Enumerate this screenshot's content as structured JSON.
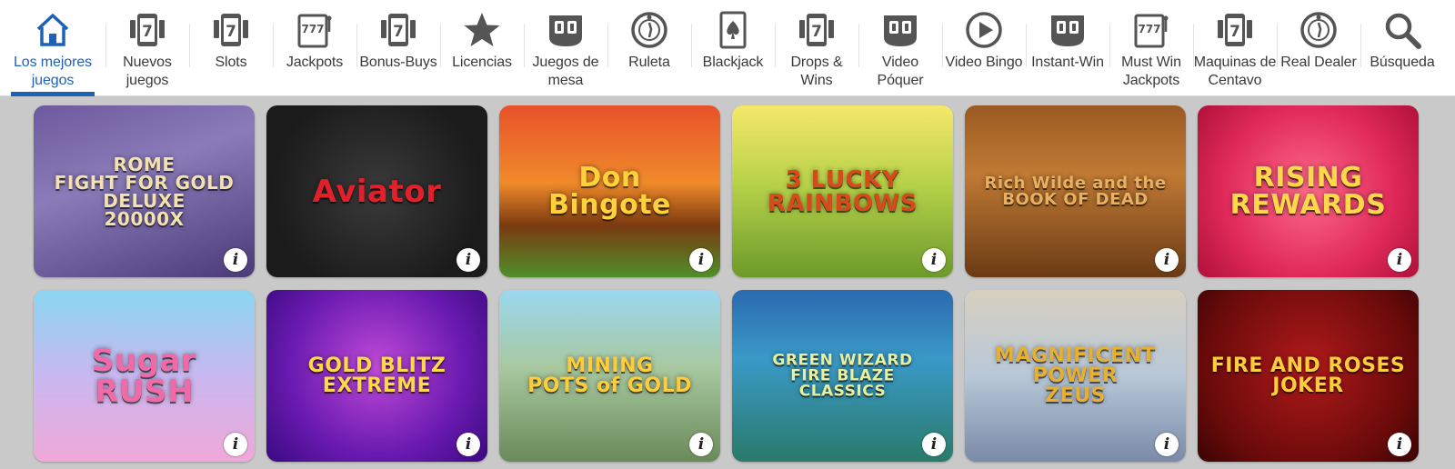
{
  "nav": {
    "items": [
      {
        "label": "Los mejores\njuegos",
        "icon": "home-icon",
        "active": true
      },
      {
        "label": "Nuevos\njuegos",
        "icon": "slot-phone-icon"
      },
      {
        "label": "Slots",
        "icon": "slot-phone-icon"
      },
      {
        "label": "Jackpots",
        "icon": "triple-seven-icon"
      },
      {
        "label": "Bonus-Buys",
        "icon": "slot-phone-icon"
      },
      {
        "label": "Licencias",
        "icon": "star-icon"
      },
      {
        "label": "Juegos de\nmesa",
        "icon": "video-poker-icon"
      },
      {
        "label": "Ruleta",
        "icon": "roulette-icon"
      },
      {
        "label": "Blackjack",
        "icon": "spade-card-icon"
      },
      {
        "label": "Drops &\nWins",
        "icon": "slot-phone-icon"
      },
      {
        "label": "Video\nPóquer",
        "icon": "video-poker-icon"
      },
      {
        "label": "Video Bingo",
        "icon": "play-icon"
      },
      {
        "label": "Instant-Win",
        "icon": "video-poker-icon"
      },
      {
        "label": "Must Win\nJackpots",
        "icon": "triple-seven-icon"
      },
      {
        "label": "Maquinas de\nCentavo",
        "icon": "slot-phone-icon"
      },
      {
        "label": "Real Dealer",
        "icon": "roulette-icon"
      },
      {
        "label": "Búsqueda",
        "icon": "search-icon"
      }
    ],
    "accent": "#1e62b8"
  },
  "games": [
    {
      "name": "ROME\nFIGHT FOR GOLD\nDELUXE\n20000X",
      "bg": "linear-gradient(160deg,#6d5a9e 0%,#8b7bb8 40%,#4a3a78 100%)",
      "color": "#f2e2b0",
      "size": "20px"
    },
    {
      "name": "Aviator",
      "bg": "radial-gradient(circle at 50% 50%,#3a3a3a 0%,#1b1b1b 75%)",
      "color": "#e0202a",
      "size": "34px"
    },
    {
      "name": "Don\nBingote",
      "bg": "linear-gradient(180deg,#e8522a 0%,#f08a2a 45%,#7a3a10 70%,#4f8f2a 100%)",
      "color": "#ffd23a",
      "size": "30px"
    },
    {
      "name": "3 LUCKY\nRAINBOWS",
      "bg": "linear-gradient(180deg,#f5e86a 0%,#b8d24a 45%,#6c9a2a 100%)",
      "color": "#d84a1a",
      "size": "26px"
    },
    {
      "name": "Rich Wilde and the\nBOOK OF DEAD",
      "bg": "linear-gradient(180deg,#9a5a22 0%,#c07a34 40%,#6a3a14 100%)",
      "color": "#e9b060",
      "size": "18px"
    },
    {
      "name": "RISING\nREWARDS",
      "bg": "radial-gradient(circle at 50% 50%,#ff6a8a 0%,#e02a5a 60%,#b0103a 100%)",
      "color": "#ffd84a",
      "size": "30px"
    },
    {
      "name": "Sugar\nRUSH",
      "bg": "linear-gradient(180deg,#8ad6f0 0%,#c9b8f0 50%,#f0a8d8 100%)",
      "color": "#f06aa8",
      "size": "34px"
    },
    {
      "name": "GOLD BLITZ\nEXTREME",
      "bg": "radial-gradient(circle at 50% 45%,#c04ad8 0%,#6a1ab0 60%,#3a0a80 100%)",
      "color": "#ffd84a",
      "size": "22px"
    },
    {
      "name": "MINING\nPOTS of GOLD",
      "bg": "linear-gradient(180deg,#9ad8f0 0%,#a8c8a0 45%,#6a8a5a 100%)",
      "color": "#ffcc3a",
      "size": "22px"
    },
    {
      "name": "GREEN WIZARD\nFIRE BLAZE\nCLASSICS",
      "bg": "linear-gradient(180deg,#2a6ab0 0%,#3a9ac8 40%,#2a7a6a 100%)",
      "color": "#e8f0a0",
      "size": "17px"
    },
    {
      "name": "MAGNIFICENT\nPOWER\nZEUS",
      "bg": "linear-gradient(180deg,#d8d0c0 0%,#b8c8d8 50%,#7a8aa8 100%)",
      "color": "#e8b030",
      "size": "22px"
    },
    {
      "name": "FIRE AND ROSES\nJOKER",
      "bg": "radial-gradient(circle at 50% 45%,#b01a1a 0%,#6a0a0a 70%,#3a0404 100%)",
      "color": "#ffcc3a",
      "size": "22px"
    }
  ],
  "info_label": "i"
}
